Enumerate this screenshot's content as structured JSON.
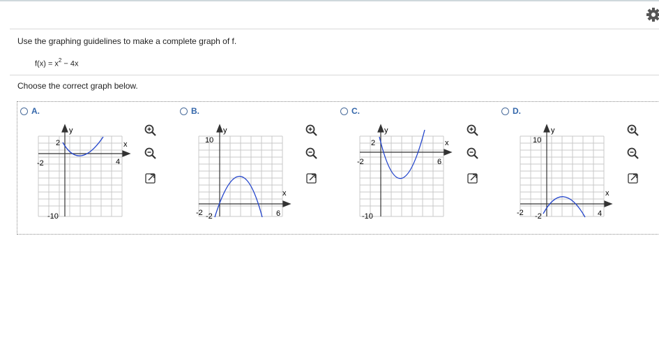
{
  "question": {
    "instruction": "Use the graphing guidelines to make a complete graph of f.",
    "function_prefix": "f(x) = x",
    "function_exponent": "2",
    "function_suffix": " − 4x",
    "prompt": "Choose the correct graph below."
  },
  "colors": {
    "curve": "#2244cc",
    "accent": "#3366aa",
    "grid": "#c8c8c8",
    "axis": "#333333"
  },
  "icons": {
    "settings": "gear-icon",
    "zoom_in": "zoom-in-icon",
    "zoom_out": "zoom-out-icon",
    "open": "open-new-window-icon"
  },
  "options": [
    {
      "letter": "A.",
      "ylabel": "y",
      "xlabel": "x",
      "ticks": [
        "2",
        "-2",
        "4",
        "-10"
      ]
    },
    {
      "letter": "B.",
      "ylabel": "y",
      "xlabel": "x",
      "ticks": [
        "10",
        "-2",
        "-2",
        "6"
      ]
    },
    {
      "letter": "C.",
      "ylabel": "y",
      "xlabel": "x",
      "ticks": [
        "2",
        "-2",
        "6",
        "-10"
      ]
    },
    {
      "letter": "D.",
      "ylabel": "y",
      "xlabel": "x",
      "ticks": [
        "10",
        "-2",
        "-2",
        "4"
      ]
    }
  ]
}
